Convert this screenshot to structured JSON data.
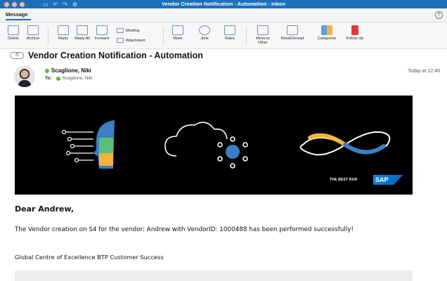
{
  "window": {
    "title": "Vendor Creation Notification - Automation  - Inbox"
  },
  "ribbon": {
    "active_tab": "Message",
    "help": "?"
  },
  "toolbar": {
    "delete": "Delete",
    "archive": "Archive",
    "reply": "Reply",
    "reply_all": "Reply All",
    "forward": "Forward",
    "meeting": "Meeting",
    "attachment": "Attachment",
    "move": "Move",
    "junk": "Junk",
    "rules": "Rules",
    "move_to_other": "Move to Other",
    "read_unread": "Read/Unread",
    "categorize": "Categorize",
    "follow_up": "Follow Up"
  },
  "message": {
    "subject": "Vendor Creation Notification - Automation",
    "sender": "Scaglione, Niki",
    "to_label": "To:",
    "to_name": "Scaglione, Niki",
    "timestamp": "Today at 12:40"
  },
  "banner": {
    "tagline": "THE BEST RUN",
    "logo": "SAP"
  },
  "body": {
    "greeting": "Dear Andrew,",
    "paragraph": "The Vendor creation on S4 for the vendor: Andrew with VendorID: 1000488 has been performed successfully!",
    "signature": "Global Centre of Excellence BTP Customer Success"
  },
  "colors": {
    "title_bar": "#1d6fb8",
    "accent": "#1f6fc5",
    "presence": "#5cbf2a"
  }
}
